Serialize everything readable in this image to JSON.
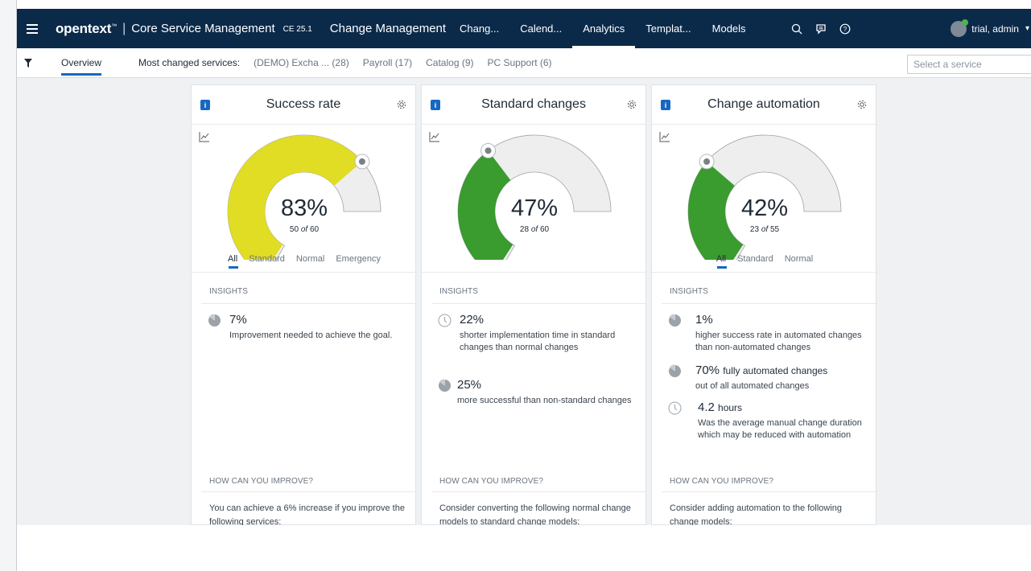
{
  "app": {
    "brand": "opentext",
    "brand_mark": "™",
    "product": "Core Service Management",
    "version": "CE 25.1",
    "module": "Change Management",
    "nav_tabs": [
      "Chang...",
      "Calend...",
      "Analytics",
      "Templat...",
      "Models"
    ],
    "active_tab": "Analytics",
    "user": "trial, admin",
    "icons": [
      "search-icon",
      "chat-icon",
      "help-icon"
    ]
  },
  "subbar": {
    "overview": "Overview",
    "most_changed_label": "Most changed services:",
    "services": [
      "(DEMO) Excha ... (28)",
      "Payroll (17)",
      "Catalog (9)",
      "PC Support (6)"
    ],
    "select_placeholder": "Select a service"
  },
  "cards": [
    {
      "title": "Success rate",
      "percent": "83%",
      "fraction": 0.83,
      "count_a": "50",
      "of": "of",
      "count_b": "60",
      "color": "#e1dc24",
      "tabs": [
        "All",
        "Standard",
        "Normal",
        "Emergency"
      ],
      "insights_label": "INSIGHTS",
      "insights": [
        {
          "icon": "pie-icon",
          "value": "7%",
          "unit": "",
          "text": "Improvement needed to achieve the goal."
        }
      ],
      "improve_label": "HOW CAN YOU IMPROVE?",
      "improve_text": "You can achieve a 6% increase if you improve the following services:"
    },
    {
      "title": "Standard changes",
      "percent": "47%",
      "fraction": 0.47,
      "count_a": "28",
      "of": "of",
      "count_b": "60",
      "color": "#3a9b2e",
      "tabs": [],
      "insights_label": "INSIGHTS",
      "insights": [
        {
          "icon": "clock-icon",
          "value": "22%",
          "unit": "",
          "text": "shorter implementation time in standard changes than normal changes"
        },
        {
          "icon": "pie-icon",
          "value": "25%",
          "unit": "",
          "text": "more successful than non-standard changes"
        }
      ],
      "improve_label": "HOW CAN YOU IMPROVE?",
      "improve_text": "Consider converting the following normal change models to standard change models:"
    },
    {
      "title": "Change automation",
      "percent": "42%",
      "fraction": 0.42,
      "count_a": "23",
      "of": "of",
      "count_b": "55",
      "color": "#3a9b2e",
      "tabs": [
        "All",
        "Standard",
        "Normal"
      ],
      "insights_label": "INSIGHTS",
      "insights": [
        {
          "icon": "pie-icon",
          "value": "1%",
          "unit": "",
          "text": "higher success rate in automated changes than non-automated changes"
        },
        {
          "icon": "pie-icon",
          "value": "70%",
          "unit": "fully automated changes",
          "text": "out of all automated changes"
        },
        {
          "icon": "clock-icon",
          "value": "4.2",
          "unit": "hours",
          "text": "Was the average manual change duration which may be reduced with automation"
        }
      ],
      "improve_label": "HOW CAN YOU IMPROVE?",
      "improve_text": "Consider adding automation to the following change models:"
    }
  ]
}
